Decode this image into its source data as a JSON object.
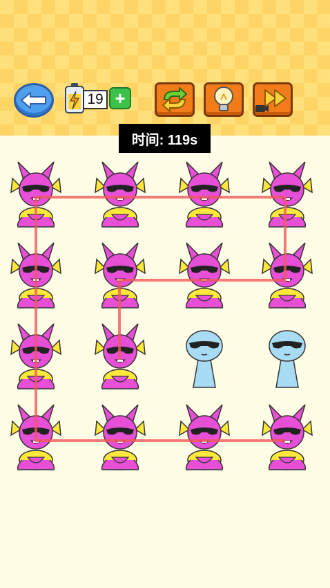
{
  "hud": {
    "energy_count": "19",
    "plus_label": "+",
    "timer_text": "时间: 119s"
  },
  "icons": {
    "back": "back-arrow-icon",
    "energy": "battery-lightning-icon",
    "restart": "refresh-arrows-icon",
    "hint": "lightbulb-icon",
    "skip": "fast-forward-video-icon"
  },
  "colors": {
    "top_band": "#ffe07a",
    "board_bg": "#fffde5",
    "pink_character": "#e64fd6",
    "yellow_body": "#ffe83c",
    "blue_character": "#a8dcf5",
    "path_line": "#f05a5a",
    "orange_button": "#f27c1a",
    "back_button": "#4ea0ee"
  },
  "board": {
    "rows": 4,
    "cols": 4,
    "grid": [
      [
        "pink",
        "pink",
        "pink",
        "pink"
      ],
      [
        "pink",
        "pink",
        "pink",
        "pink"
      ],
      [
        "pink",
        "pink",
        "blue",
        "blue"
      ],
      [
        "pink",
        "pink",
        "pink",
        "pink"
      ]
    ],
    "path": [
      [
        0,
        3
      ],
      [
        0,
        0
      ],
      [
        3,
        0
      ],
      [
        3,
        3
      ]
    ],
    "path2": [
      [
        0,
        3
      ],
      [
        1,
        3
      ],
      [
        1,
        1
      ],
      [
        2,
        1
      ]
    ]
  }
}
